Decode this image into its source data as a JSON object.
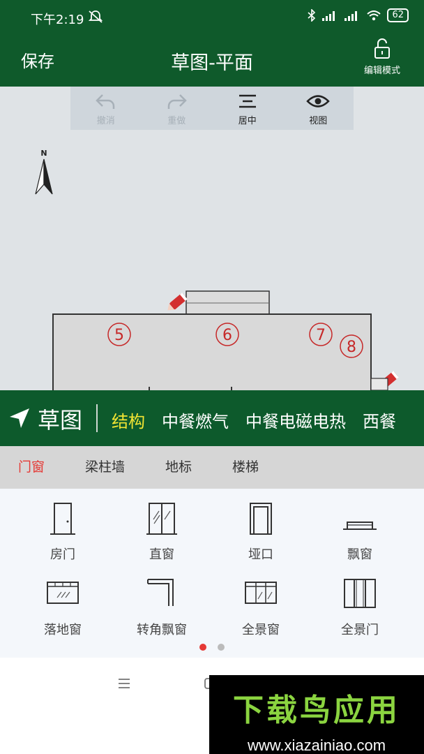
{
  "status_bar": {
    "time": "下午2:19",
    "battery": "62",
    "icons": [
      "mute-icon",
      "bluetooth-icon",
      "signal-icon",
      "signal-icon",
      "wifi-icon",
      "battery-icon"
    ]
  },
  "title_bar": {
    "save_label": "保存",
    "title": "草图-平面",
    "edit_mode_label": "编辑模式",
    "edit_icon": "unlock-icon"
  },
  "canvas_toolbar": {
    "undo_label": "撤消",
    "redo_label": "重做",
    "center_label": "居中",
    "view_label": "视图"
  },
  "compass": {
    "label": "N"
  },
  "plan": {
    "room_numbers": [
      "5",
      "6",
      "7",
      "8"
    ]
  },
  "category_bar": {
    "sketch_label": "草图",
    "tabs": [
      "结构",
      "中餐燃气",
      "中餐电磁电热",
      "西餐"
    ],
    "active_tab": "结构"
  },
  "sub_tabs": {
    "items": [
      "门窗",
      "梁柱墙",
      "地标",
      "楼梯"
    ],
    "active": "门窗"
  },
  "items": [
    {
      "label": "房门",
      "icon": "door-icon"
    },
    {
      "label": "直窗",
      "icon": "straight-window-icon"
    },
    {
      "label": "垭口",
      "icon": "opening-icon"
    },
    {
      "label": "飘窗",
      "icon": "bay-window-icon"
    },
    {
      "label": "落地窗",
      "icon": "floor-window-icon"
    },
    {
      "label": "转角飘窗",
      "icon": "corner-bay-window-icon"
    },
    {
      "label": "全景窗",
      "icon": "panoramic-window-icon"
    },
    {
      "label": "全景门",
      "icon": "panoramic-door-icon"
    }
  ],
  "pager": {
    "pages": 2,
    "current": 1
  },
  "watermark": {
    "logo": "下载鸟应用",
    "url": "www.xiazainiao.com"
  },
  "colors": {
    "brand_green": "#0f5a2b",
    "active_tab_yellow": "#f3e533",
    "active_subtab_red": "#e53935"
  }
}
